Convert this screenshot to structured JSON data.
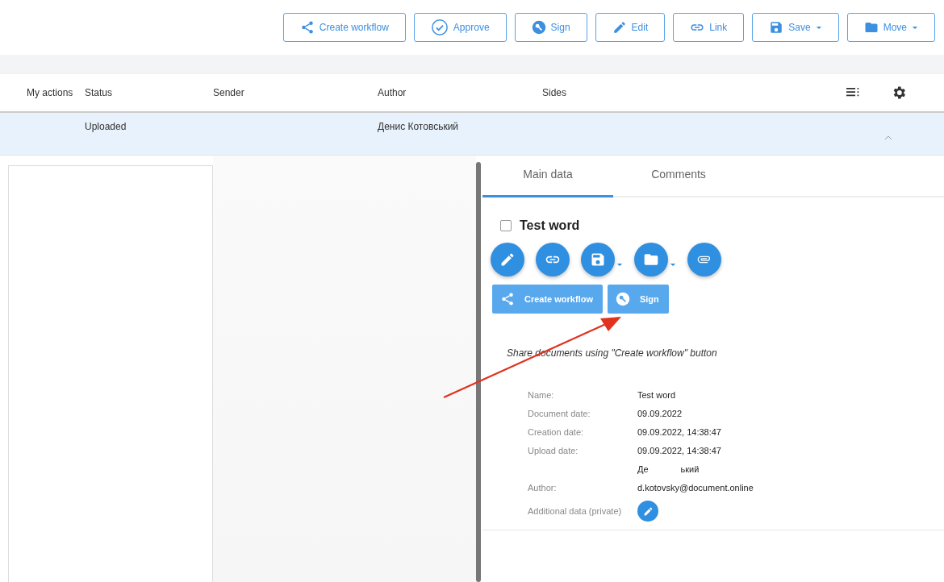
{
  "toolbar": {
    "buttons": [
      {
        "kind": "share",
        "label": "Create workflow",
        "dropdown": false
      },
      {
        "kind": "approve",
        "label": "Approve",
        "dropdown": false
      },
      {
        "kind": "sign",
        "label": "Sign",
        "dropdown": false
      },
      {
        "kind": "edit",
        "label": "Edit",
        "dropdown": false
      },
      {
        "kind": "link",
        "label": "Link",
        "dropdown": false
      },
      {
        "kind": "save",
        "label": "Save",
        "dropdown": true
      },
      {
        "kind": "folder",
        "label": "Move",
        "dropdown": true
      }
    ]
  },
  "table": {
    "columns": [
      "My actions",
      "Status",
      "Sender",
      "Author",
      "Sides"
    ],
    "rows": [
      {
        "selected": true,
        "expanded": true,
        "cells": [
          "",
          "Uploaded",
          "",
          "Денис Котовський",
          ""
        ]
      }
    ]
  },
  "panel": {
    "tabs": [
      {
        "label": "Main data",
        "selected": true
      },
      {
        "label": "Comments",
        "selected": false
      }
    ],
    "document": {
      "title": "Test word",
      "checked": false
    },
    "round_buttons": [
      {
        "kind": "edit",
        "dropdown": false
      },
      {
        "kind": "link",
        "dropdown": false
      },
      {
        "kind": "save",
        "dropdown": true
      },
      {
        "kind": "folder",
        "dropdown": true
      },
      {
        "kind": "attach",
        "dropdown": false
      }
    ],
    "action_buttons": [
      {
        "kind": "share",
        "label": "Create workflow"
      },
      {
        "kind": "sign",
        "label": "Sign"
      }
    ],
    "hint": "Share documents using \"Create workflow\" button",
    "details": [
      {
        "label": "Name:",
        "value": "Test word"
      },
      {
        "label": "Document date:",
        "value": "09.09.2022"
      },
      {
        "label": "Creation date:",
        "value": "09.09.2022, 14:38:47"
      },
      {
        "label": "Upload date:",
        "value": "09.09.2022, 14:38:47"
      },
      {
        "value_parts": [
          "Де",
          "ький"
        ]
      },
      {
        "label": "Author:",
        "value": "d.kotovsky@document.online"
      },
      {
        "label": "Additional data (private)",
        "kind": "edit"
      }
    ]
  }
}
